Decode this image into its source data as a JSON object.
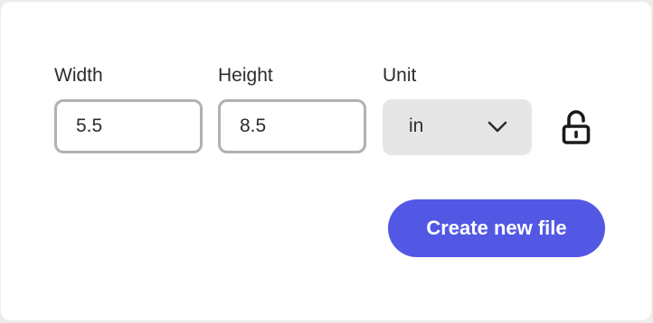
{
  "dimensions": {
    "width": {
      "label": "Width",
      "value": "5.5"
    },
    "height": {
      "label": "Height",
      "value": "8.5"
    },
    "unit": {
      "label": "Unit",
      "selected": "in"
    }
  },
  "icons": {
    "unit_dropdown": "chevron-down-icon",
    "aspect_lock": "unlocked-padlock-icon"
  },
  "actions": {
    "create_label": "Create new file"
  },
  "colors": {
    "primary_button": "#5258e4",
    "input_border": "#b1b1b1",
    "select_background": "#e6e6e6"
  }
}
